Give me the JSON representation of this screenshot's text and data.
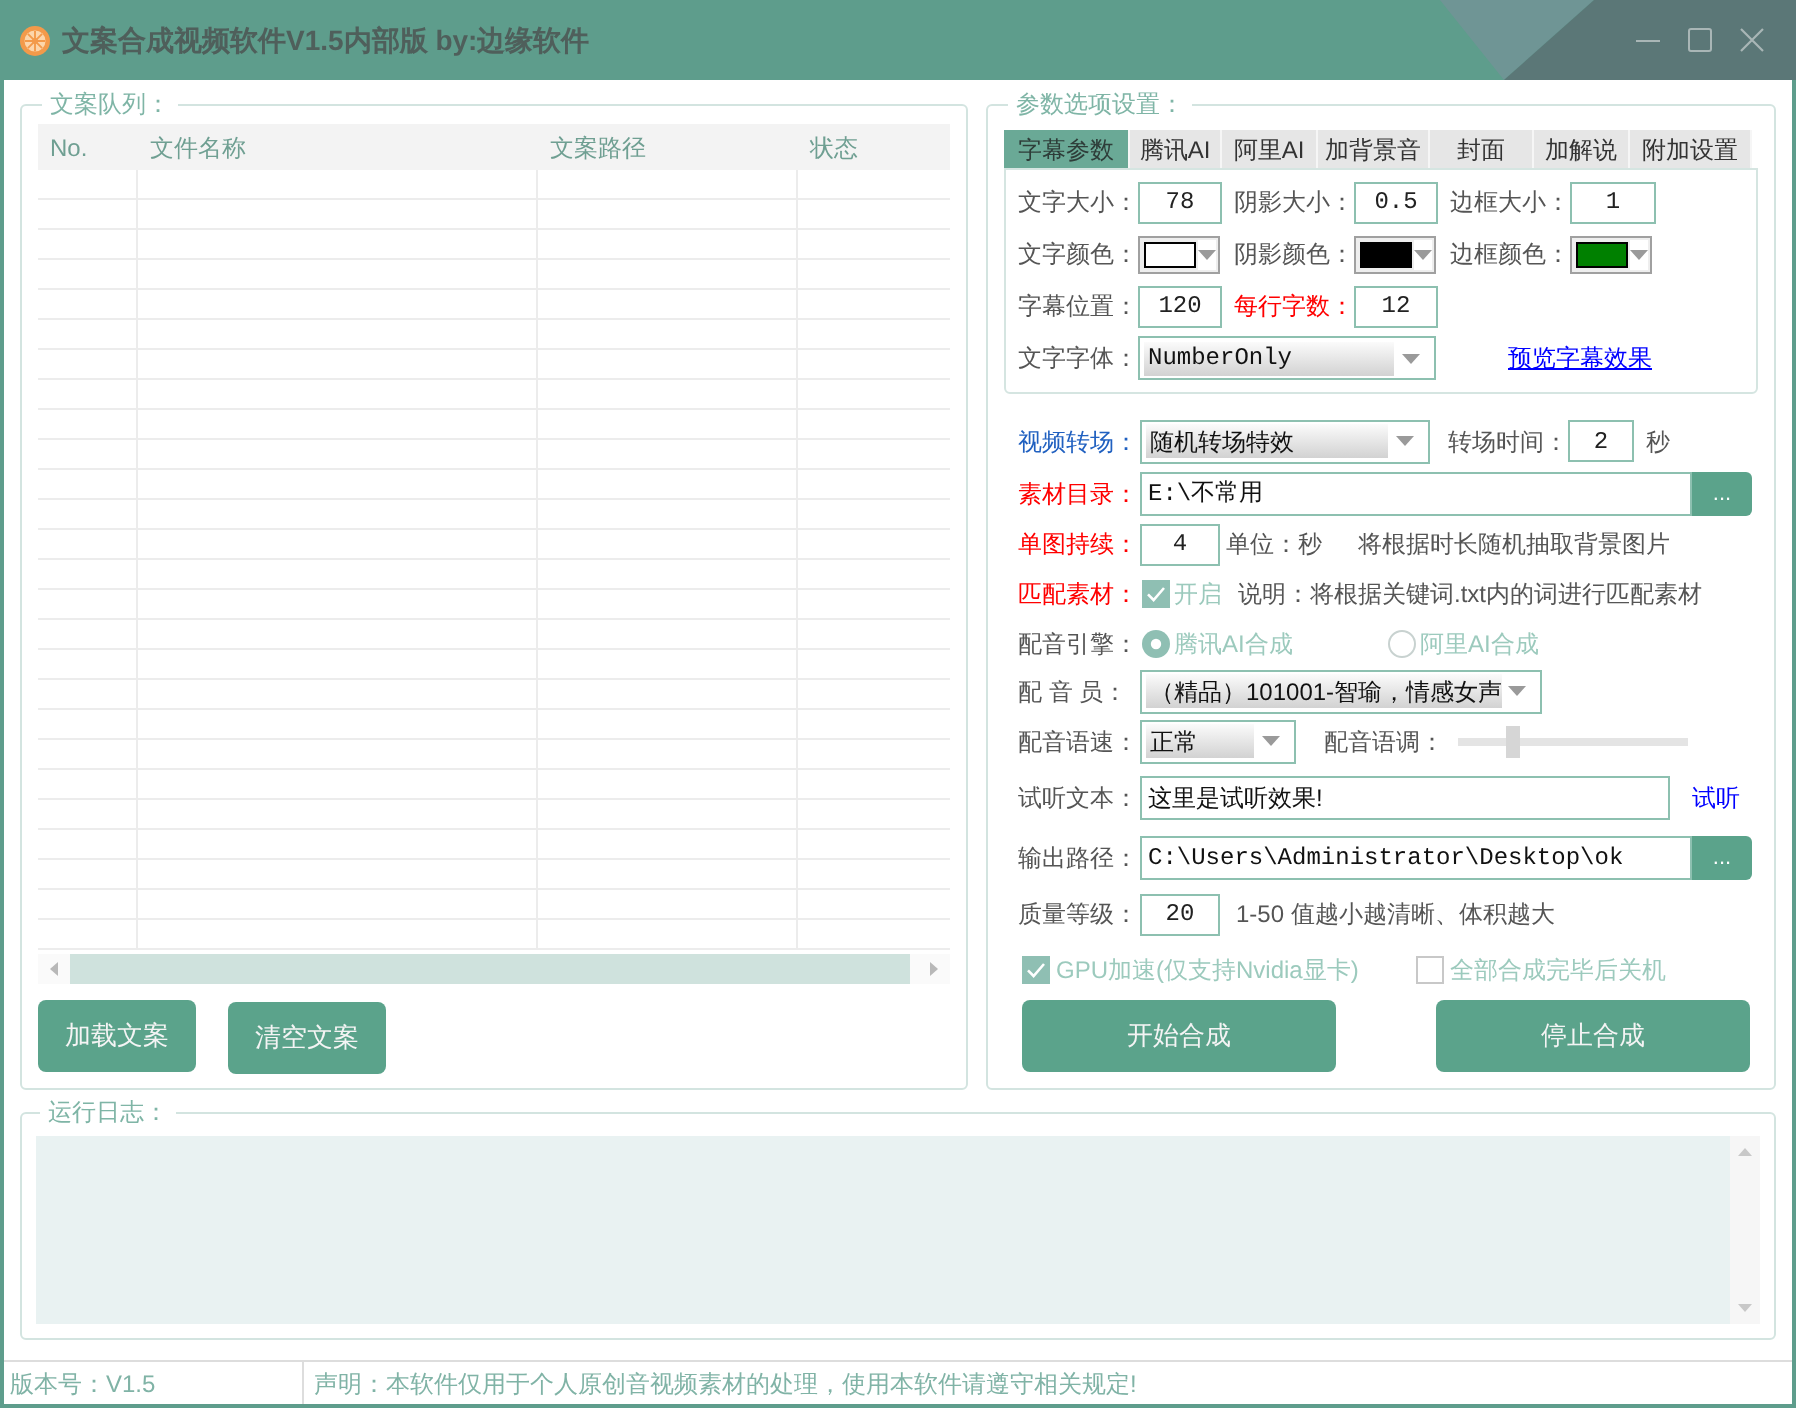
{
  "window": {
    "title": "文案合成视频软件V1.5内部版 by:边缘软件"
  },
  "queue": {
    "legend": "文案队列：",
    "columns": [
      "No.",
      "文件名称",
      "文案路径",
      "状态"
    ],
    "buttons": [
      "加载文案",
      "清空文案"
    ]
  },
  "settings": {
    "legend": "参数选项设置：",
    "tabs": [
      {
        "label": "字幕参数",
        "selected": true
      },
      {
        "label": "腾讯AI",
        "selected": false
      },
      {
        "label": "阿里AI",
        "selected": false
      },
      {
        "label": "加背景音",
        "selected": false
      },
      {
        "label": "封面",
        "selected": false
      },
      {
        "label": "加解说",
        "selected": false
      },
      {
        "label": "附加设置",
        "selected": false
      }
    ],
    "subtitle": {
      "font_size": {
        "label": "文字大小：",
        "value": "78"
      },
      "shadow_size": {
        "label": "阴影大小：",
        "value": "0.5"
      },
      "border_size": {
        "label": "边框大小：",
        "value": "1"
      },
      "text_color": {
        "label": "文字颜色：",
        "color": "#ffffff"
      },
      "shadow_color": {
        "label": "阴影颜色：",
        "color": "#000000"
      },
      "border_color": {
        "label": "边框颜色：",
        "color": "#008000"
      },
      "position": {
        "label": "字幕位置：",
        "value": "120"
      },
      "chars_per_line": {
        "label": "每行字数：",
        "color": "#ff0000",
        "value": "12"
      },
      "font": {
        "label": "文字字体：",
        "value": "NumberOnly"
      },
      "preview_link": "预览字幕效果"
    },
    "transition": {
      "label": "视频转场：",
      "color": "#2060c0",
      "value": "随机转场特效",
      "time_label": "转场时间：",
      "time": "2",
      "unit": "秒"
    },
    "material_dir": {
      "label": "素材目录：",
      "color": "#ff0000",
      "value": "E:\\不常用",
      "browse": "..."
    },
    "image_duration": {
      "label": "单图持续：",
      "color": "#ff0000",
      "value": "4",
      "unit": "单位：秒",
      "note": "将根据时长随机抽取背景图片"
    },
    "match_material": {
      "label": "匹配素材：",
      "color": "#ff0000",
      "checkbox": {
        "label": "开启",
        "checked": true,
        "disabled": true
      },
      "note": "说明：将根据关键词.txt内的词进行匹配素材"
    },
    "engine": {
      "label": "配音引擎：",
      "options": [
        {
          "label": "腾讯AI合成",
          "selected": true,
          "disabled": true
        },
        {
          "label": "阿里AI合成",
          "selected": false,
          "disabled": true
        }
      ]
    },
    "voice": {
      "label": "配 音 员：",
      "value": "（精品）101001-智瑜，情感女声"
    },
    "speed": {
      "label": "配音语速：",
      "value": "正常"
    },
    "pitch": {
      "label": "配音语调：",
      "level": 0.24
    },
    "preview_text": {
      "label": "试听文本：",
      "value": "这里是试听效果!",
      "link": "试听"
    },
    "output": {
      "label": "输出路径：",
      "value": "C:\\Users\\Administrator\\Desktop\\ok",
      "browse": "..."
    },
    "quality": {
      "label": "质量等级：",
      "value": "20",
      "note": "1-50 值越小越清晰、体积越大"
    },
    "options": [
      {
        "label": "GPU加速(仅支持Nvidia显卡)",
        "checked": true,
        "disabled": true
      },
      {
        "label": "全部合成完毕后关机",
        "checked": false,
        "disabled": true
      }
    ],
    "buttons": [
      "开始合成",
      "停止合成"
    ]
  },
  "log": {
    "legend": "运行日志："
  },
  "status_bar": {
    "version": "版本号：V1.5",
    "notice": "声明：本软件仅用于个人原创音视频素材的处理，使用本软件请遵守相关规定!"
  }
}
